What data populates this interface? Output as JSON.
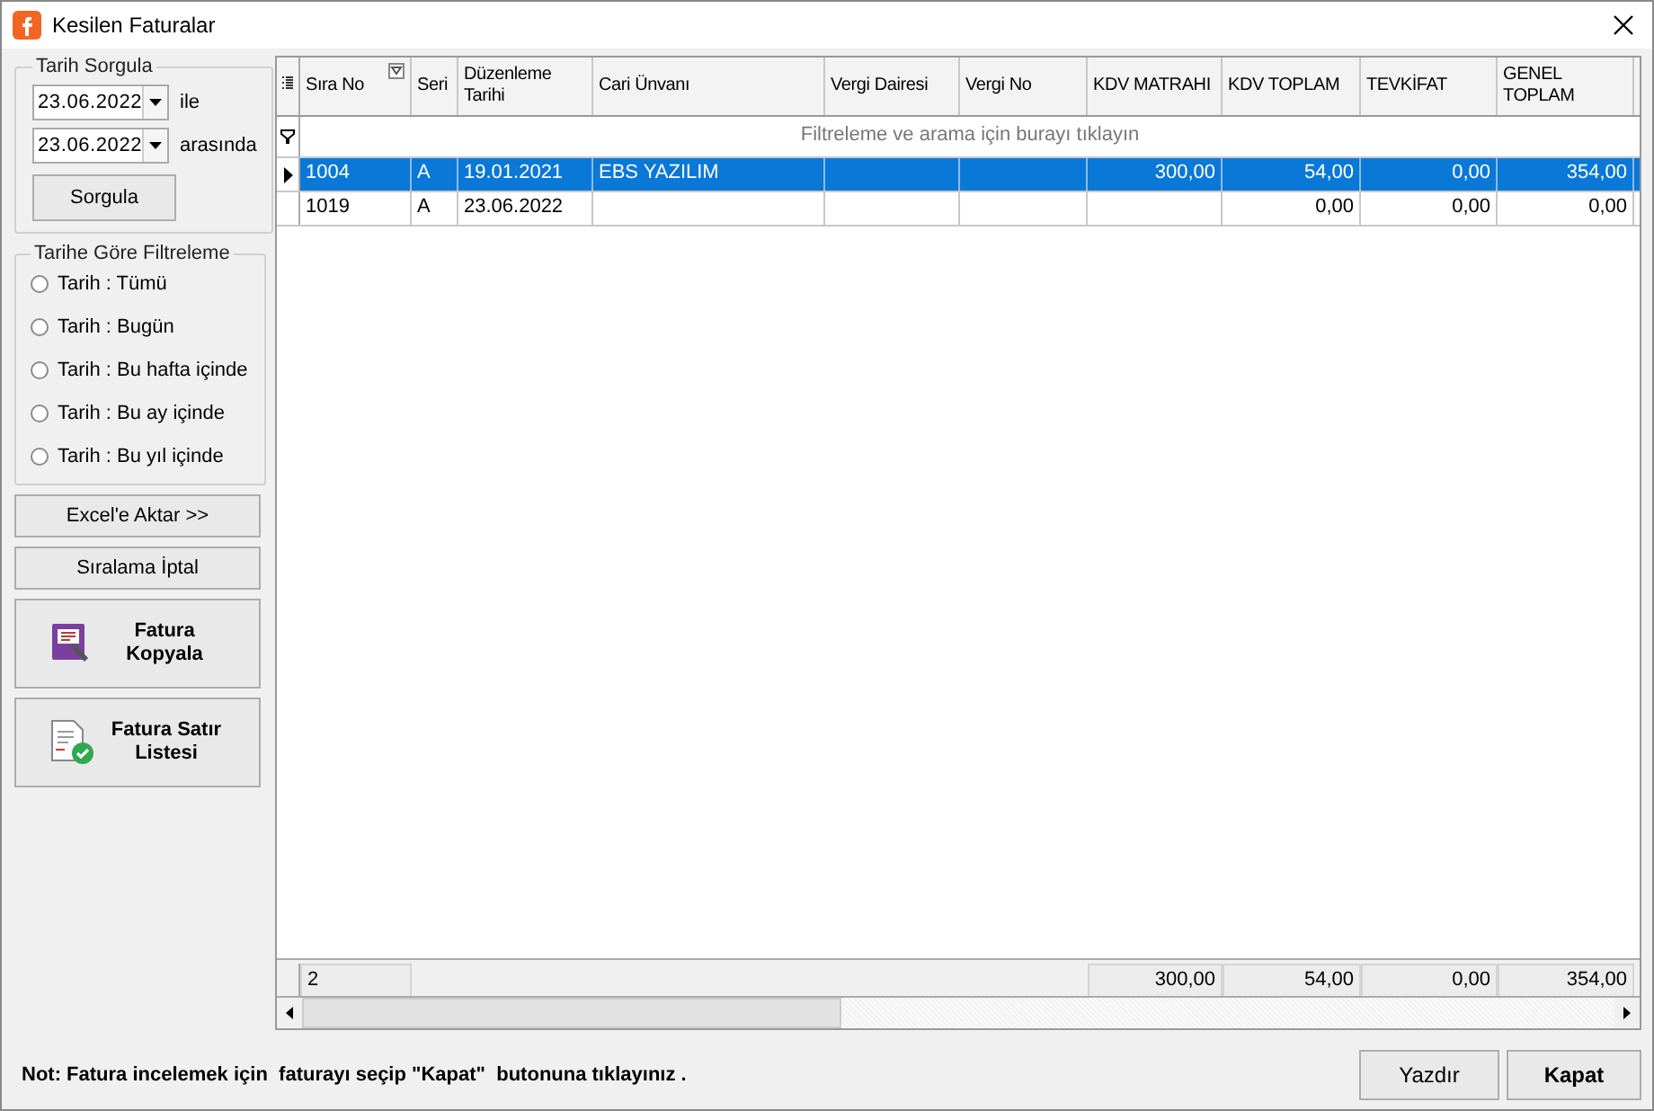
{
  "window": {
    "title": "Kesilen Faturalar"
  },
  "date_query": {
    "title": "Tarih Sorgula",
    "start_date": "23.06.2022",
    "start_suffix": "ile",
    "end_date": "23.06.2022",
    "end_suffix": "arasında",
    "button": "Sorgula"
  },
  "date_filter": {
    "title": "Tarihe Göre Filtreleme",
    "options": [
      {
        "label": "Tarih : Tümü",
        "selected": false
      },
      {
        "label": "Tarih : Bugün",
        "selected": false
      },
      {
        "label": "Tarih : Bu hafta içinde",
        "selected": false
      },
      {
        "label": "Tarih : Bu ay içinde",
        "selected": false
      },
      {
        "label": "Tarih : Bu yıl içinde",
        "selected": false
      }
    ]
  },
  "actions": [
    {
      "label": "Excel'e Aktar >>",
      "kind": "plain"
    },
    {
      "label": "Sıralama İptal",
      "kind": "plain"
    },
    {
      "label": "Fatura Kopyala",
      "kind": "copy"
    },
    {
      "label": "Fatura Satır Listesi",
      "kind": "lines"
    }
  ],
  "table": {
    "columns": [
      {
        "label": "Sıra No",
        "kind": "text",
        "filter_button": true
      },
      {
        "label": "Seri",
        "kind": "text",
        "filter_button": false
      },
      {
        "label": "Düzenleme Tarihi",
        "kind": "text",
        "filter_button": false
      },
      {
        "label": "Cari Ünvanı",
        "kind": "text",
        "filter_button": false
      },
      {
        "label": "Vergi Dairesi",
        "kind": "text",
        "filter_button": false
      },
      {
        "label": "Vergi No",
        "kind": "text",
        "filter_button": false
      },
      {
        "label": "KDV MATRAHI",
        "kind": "number",
        "filter_button": false
      },
      {
        "label": "KDV TOPLAM",
        "kind": "number",
        "filter_button": false
      },
      {
        "label": "TEVKİFAT",
        "kind": "number",
        "filter_button": false
      },
      {
        "label": "GENEL TOPLAM",
        "kind": "number",
        "filter_button": false
      }
    ],
    "filter_hint": "Filtreleme ve arama için burayı tıklayın",
    "rows": [
      {
        "selected": true,
        "cells": [
          "1004",
          "A",
          "19.01.2021",
          "EBS YAZILIM",
          "",
          "",
          "300,00",
          "54,00",
          "0,00",
          "354,00"
        ]
      },
      {
        "selected": false,
        "cells": [
          "1019",
          "A",
          "23.06.2022",
          "",
          "",
          "",
          "",
          "0,00",
          "0,00",
          "0,00"
        ]
      }
    ],
    "footer": {
      "count": "2",
      "totals": [
        "300,00",
        "54,00",
        "0,00",
        "354,00"
      ]
    }
  },
  "note": "Not: Fatura incelemek için  faturayı seçip \"Kapat\"  butonuna tıklayınız .",
  "buttons": [
    {
      "label": "Yazdır",
      "kind": "default"
    },
    {
      "label": "Kapat",
      "kind": "primary"
    }
  ]
}
